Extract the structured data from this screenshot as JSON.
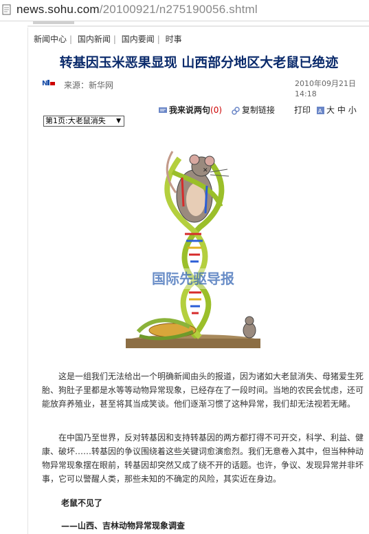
{
  "browser": {
    "url_host": "news.sohu.com",
    "url_path": "/20100921/n275190056.shtml"
  },
  "breadcrumb": [
    "新闻中心",
    "国内新闻",
    "国内要闻",
    "时事"
  ],
  "article": {
    "title": "转基因玉米恶果显现 山西部分地区大老鼠已绝迹",
    "source": "来源：新华网",
    "date": "2010年09月21日",
    "time": "14:18"
  },
  "tools": {
    "comment_label": "我来说两句",
    "comment_count": "(0)",
    "copy_label": "复制链接",
    "print_label": "打印",
    "font_large": "大",
    "font_medium": "中",
    "font_small": "小"
  },
  "page_select": {
    "value": "第1页:大老鼠消失"
  },
  "illustration": {
    "watermark": "国际先驱导报"
  },
  "body": {
    "paragraphs": [
      "这是一组我们无法给出一个明确新闻由头的报道，因为诸如大老鼠消失、母猪爱生死胎、狗肚子里都是水等等动物异常现象，已经存在了一段时间。当地的农民会忧虑，还可能放弃养殖业，甚至将其当成笑谈。他们逐渐习惯了这种异常，我们却无法视若无睹。",
      "在中国乃至世界，反对转基因和支持转基因的两方都打得不可开交，科学、利益、健康、破坏……转基因的争议围绕着这些关键词愈演愈烈。我们无意卷入其中，但当种种动物异常现象摆在眼前，转基因却突然又成了绕不开的话题。也许，争议、发现异常并非坏事，它可以警醒人类，那些未知的不确定的风险，其实近在身边。"
    ],
    "subheading1": "老鼠不见了",
    "subheading2": "——山西、吉林动物异常现象调查"
  },
  "colors": {
    "title": "#0a2a6b",
    "comment_count": "#c00000",
    "link_blue": "#2a5db0"
  }
}
